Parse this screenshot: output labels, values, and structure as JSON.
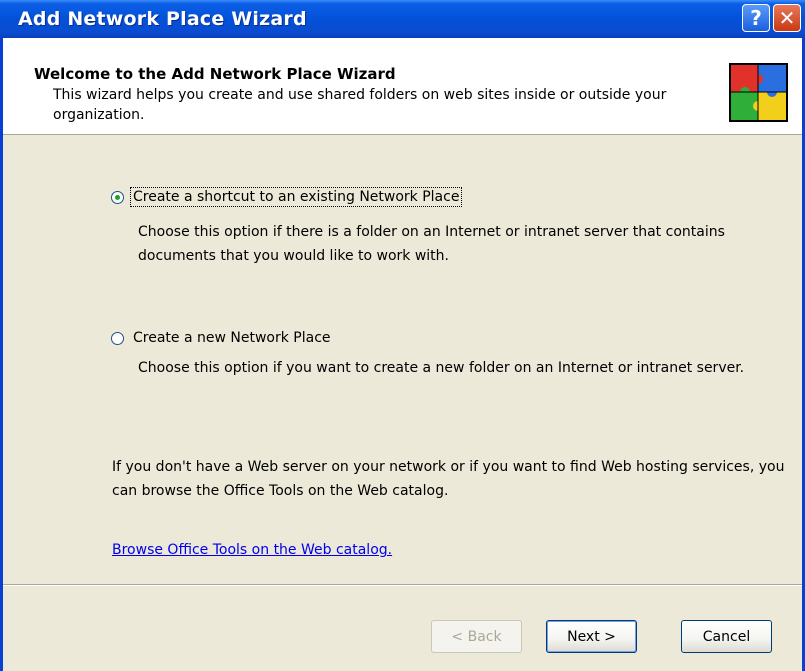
{
  "window": {
    "title": "Add Network Place Wizard",
    "help_glyph": "?",
    "close_glyph": "✕"
  },
  "header": {
    "title": "Welcome to the Add Network Place Wizard",
    "description": "This wizard helps you create and use shared folders on web sites inside or outside your organization.",
    "icon": "puzzle-pieces-icon"
  },
  "options": [
    {
      "label": "Create a shortcut to an existing Network Place",
      "description": "Choose this option if there is a folder on an Internet or intranet server that contains documents that you would like to work with.",
      "selected": true
    },
    {
      "label": "Create a new Network Place",
      "description": "Choose this option if you want to create a new folder on an Internet or intranet server.",
      "selected": false
    }
  ],
  "info_text": "If you don't have a Web server on your network or if you want to find Web hosting services, you can browse the Office Tools on the Web catalog.",
  "link_text": "Browse Office Tools on the Web catalog.",
  "buttons": {
    "back": "< Back",
    "next": "Next >",
    "cancel": "Cancel"
  },
  "colors": {
    "title_bar": "#0351d9",
    "dialog_bg": "#ece9d8",
    "link": "#0000ee"
  }
}
